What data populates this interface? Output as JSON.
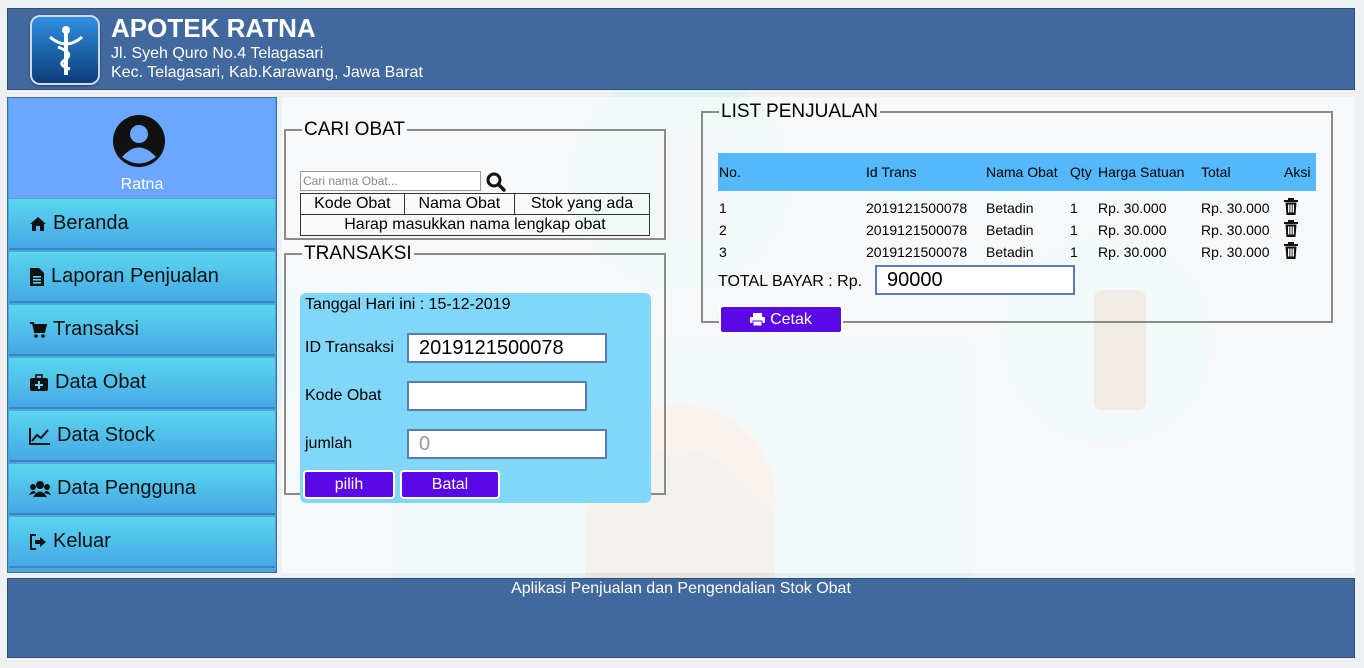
{
  "header": {
    "title": "APOTEK RATNA",
    "address_line1": "Jl. Syeh Quro No.4 Telagasari",
    "address_line2": "Kec. Telagasari, Kab.Karawang, Jawa Barat",
    "logo_icon": "caduceus-icon"
  },
  "sidebar": {
    "user_name": "Ratna",
    "items": [
      {
        "label": "Beranda",
        "icon": "home-icon"
      },
      {
        "label": "Laporan Penjualan",
        "icon": "file-icon"
      },
      {
        "label": "Transaksi",
        "icon": "cart-icon"
      },
      {
        "label": "Data Obat",
        "icon": "medkit-icon"
      },
      {
        "label": "Data Stock",
        "icon": "line-chart-icon"
      },
      {
        "label": "Data Pengguna",
        "icon": "users-icon"
      },
      {
        "label": "Keluar",
        "icon": "sign-out-icon"
      }
    ]
  },
  "cari": {
    "legend": "CARI OBAT",
    "placeholder": "Cari nama Obat...",
    "columns": [
      "Kode Obat",
      "Nama Obat",
      "Stok yang ada"
    ],
    "empty_message": "Harap masukkan nama lengkap obat"
  },
  "transaksi": {
    "legend": "TRANSAKSI",
    "tanggal": "Tanggal Hari ini : 15-12-2019",
    "id_label": "ID Transaksi",
    "id_value": "2019121500078",
    "kode_label": "Kode Obat",
    "kode_value": "",
    "jumlah_label": "jumlah",
    "jumlah_placeholder": "0",
    "pilih_label": "pilih",
    "batal_label": "Batal"
  },
  "list": {
    "legend": "LIST PENJUALAN",
    "columns": [
      "No.",
      "Id Trans",
      "Nama Obat",
      "Qty",
      "Harga Satuan",
      "Total",
      "Aksi"
    ],
    "rows": [
      {
        "no": "1",
        "id": "2019121500078",
        "nama": "Betadin",
        "qty": "1",
        "harga": "Rp. 30.000",
        "total": "Rp. 30.000"
      },
      {
        "no": "2",
        "id": "2019121500078",
        "nama": "Betadin",
        "qty": "1",
        "harga": "Rp. 30.000",
        "total": "Rp. 30.000"
      },
      {
        "no": "3",
        "id": "2019121500078",
        "nama": "Betadin",
        "qty": "1",
        "harga": "Rp. 30.000",
        "total": "Rp. 30.000"
      }
    ],
    "total_label": "TOTAL BAYAR : Rp.",
    "total_value": "90000",
    "cetak_label": "Cetak"
  },
  "footer": {
    "text": "Aplikasi Penjualan dan Pengendalian Stok Obat"
  },
  "colors": {
    "header_bg": "#42699e",
    "sidebar_item": "#4fc3ea",
    "profile_bg": "#6ba7ff",
    "button": "#5a08e6",
    "trans_box": "#80d7f8",
    "table_header": "#54b9fc"
  }
}
